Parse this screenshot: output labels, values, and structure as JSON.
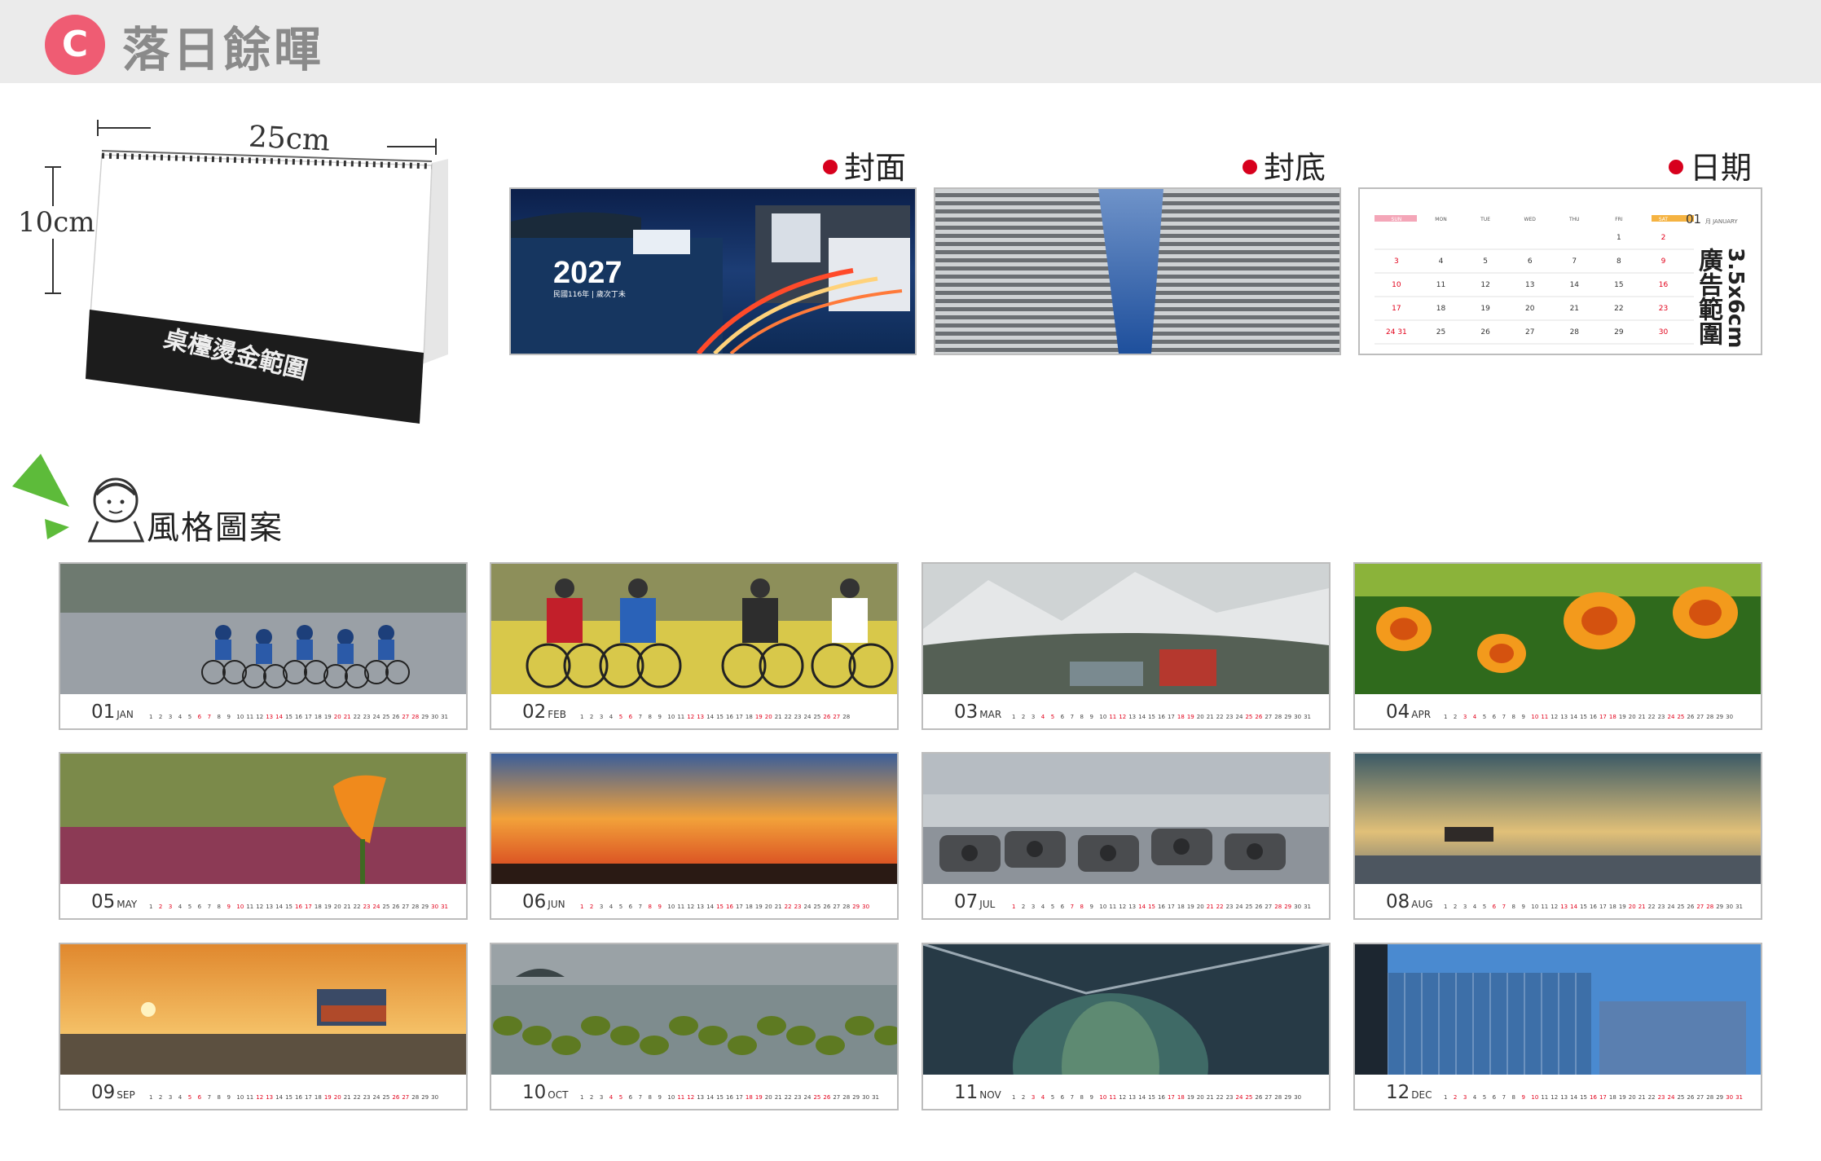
{
  "header": {
    "badge": "C",
    "title": "落日餘暉"
  },
  "desk_calendar": {
    "width_label": "25cm",
    "height_label": "10cm",
    "foil_area_label": "桌檯燙金範圍"
  },
  "sections": {
    "cover": "封面",
    "back": "封底",
    "date": "日期"
  },
  "cover": {
    "year": "2027",
    "subtitle": "民國116年 | 歲次丁未"
  },
  "date_page": {
    "month": "01",
    "month_small": "月 JANUARY",
    "weekdays": [
      "SUN",
      "MON",
      "TUE",
      "WED",
      "THU",
      "FRI",
      "SAT"
    ],
    "rows": [
      [
        "",
        "",
        "",
        "",
        "",
        "1",
        "2"
      ],
      [
        "3",
        "4",
        "5",
        "6",
        "7",
        "8",
        "9"
      ],
      [
        "10",
        "11",
        "12",
        "13",
        "14",
        "15",
        "16"
      ],
      [
        "17",
        "18",
        "19",
        "20",
        "21",
        "22",
        "23"
      ],
      [
        "24 31",
        "25",
        "26",
        "27",
        "28",
        "29",
        "30"
      ]
    ],
    "ad_size": "3.5x6cm",
    "ad_label": "廣告範圍",
    "colors": {
      "sun": "#f4a6b8",
      "sat": "#f5b342",
      "red": "#e2001a"
    }
  },
  "styles_heading": "風格圖案",
  "months": [
    {
      "num": "01",
      "abbr": "JAN",
      "photo": "cycling-race"
    },
    {
      "num": "02",
      "abbr": "FEB",
      "photo": "cyclists-closeup"
    },
    {
      "num": "03",
      "abbr": "MAR",
      "photo": "snowy-mountain"
    },
    {
      "num": "04",
      "abbr": "APR",
      "photo": "calla-lilies"
    },
    {
      "num": "05",
      "abbr": "MAY",
      "photo": "single-calla-lily"
    },
    {
      "num": "06",
      "abbr": "JUN",
      "photo": "sunset-sky"
    },
    {
      "num": "07",
      "abbr": "JUL",
      "photo": "coastal-rocks"
    },
    {
      "num": "08",
      "abbr": "AUG",
      "photo": "shipwreck-sea"
    },
    {
      "num": "09",
      "abbr": "SEP",
      "photo": "shipwreck-sunset"
    },
    {
      "num": "10",
      "abbr": "OCT",
      "photo": "mossy-reef"
    },
    {
      "num": "11",
      "abbr": "NOV",
      "photo": "glass-dome"
    },
    {
      "num": "12",
      "abbr": "DEC",
      "photo": "glass-building"
    }
  ]
}
